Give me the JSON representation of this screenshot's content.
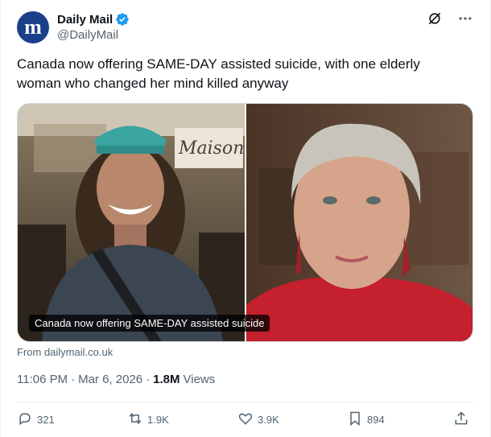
{
  "author": {
    "display_name": "Daily Mail",
    "handle": "@DailyMail",
    "avatar_letter": "m",
    "avatar_color": "#1b3f8a",
    "verified_color": "#1d9bf0"
  },
  "tweet": {
    "text": "Canada now offering SAME-DAY assisted suicide, with one elderly woman who changed her mind killed anyway"
  },
  "media": {
    "caption": "Canada now offering SAME-DAY assisted suicide",
    "left_image_sign": "Maison",
    "source": "From dailymail.co.uk"
  },
  "meta": {
    "time": "11:06 PM",
    "date": "Mar 6, 2026",
    "views_count": "1.8M",
    "views_label": "Views"
  },
  "actions": {
    "replies": "321",
    "reposts": "1.9K",
    "likes": "3.9K",
    "bookmarks": "894"
  },
  "icons": {
    "grok": "slash-circle-icon",
    "more": "more-dots-icon",
    "reply": "reply-icon",
    "repost": "repost-icon",
    "like": "heart-icon",
    "bookmark": "bookmark-icon",
    "share": "share-icon"
  }
}
